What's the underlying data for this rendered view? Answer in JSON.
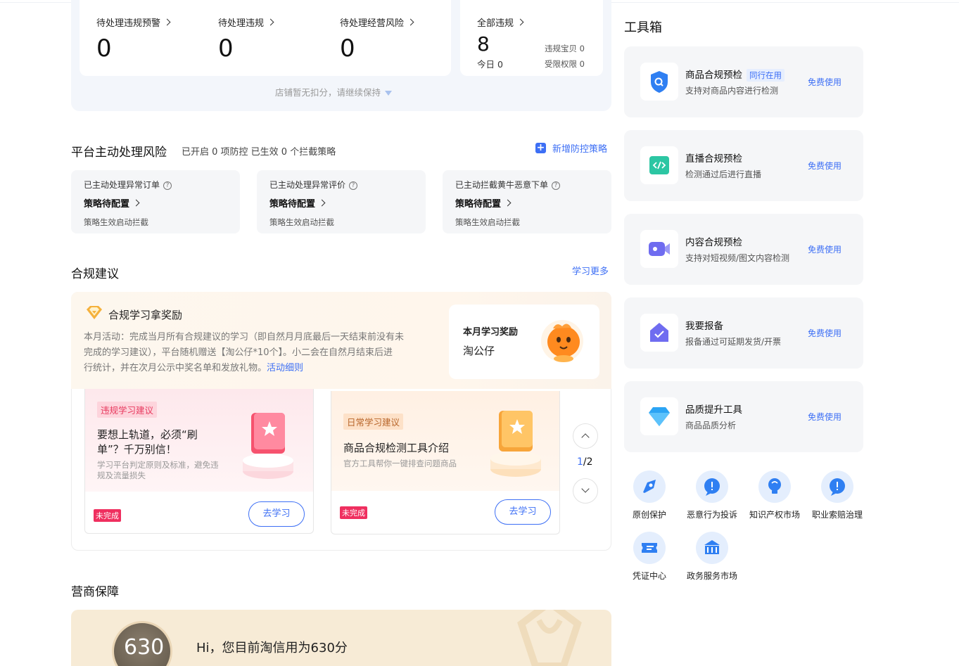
{
  "pending": {
    "items": [
      {
        "label": "待处理违规预警",
        "value": "0"
      },
      {
        "label": "待处理违规",
        "value": "0"
      },
      {
        "label": "待处理经营风险",
        "value": "0"
      }
    ],
    "all": {
      "label": "全部违规",
      "value": "8",
      "today": "今日 0",
      "baby": "违规宝贝 0",
      "limited": "受限权限 0"
    },
    "tip": "店铺暂无扣分，请继续保持"
  },
  "platform_risk": {
    "title": "平台主动处理风险",
    "summary": "已开启 0 项防控 已生效 0 个拦截策略",
    "add_label": "新增防控策略",
    "cards": [
      {
        "title": "已主动处理异常订单",
        "status": "策略待配置",
        "desc": "策略生效启动拦截"
      },
      {
        "title": "已主动处理异常评价",
        "status": "策略待配置",
        "desc": "策略生效启动拦截"
      },
      {
        "title": "已主动拦截黄牛恶意下单",
        "status": "策略待配置",
        "desc": "策略生效启动拦截"
      }
    ]
  },
  "compliance": {
    "title": "合规建议",
    "more_label": "学习更多",
    "banner_title": "合规学习拿奖励",
    "banner_lines": [
      "本月活动：完成当月所有合规建议的学习（即自然月月底最后一天结束前没有未",
      "完成的学习建议），平台随机赠送【淘公仔*10个】。小二会在自然月结束后进",
      "行统计，并在次月公示中奖名单和发放礼物。"
    ],
    "banner_link": "活动细则",
    "reward_title": "本月学习奖励",
    "reward_name": "淘公仔",
    "cards": [
      {
        "tag": "违规学习建议",
        "title_lines": [
          "要想上轨道，必须“刷",
          "单”？千万别信！"
        ],
        "desc_lines": [
          "学习平台判定原则及标准，避免违",
          "规及流量损失"
        ],
        "status": "未完成",
        "button": "去学习"
      },
      {
        "tag": "日常学习建议",
        "title_lines": [
          "商品合规检测工具介绍"
        ],
        "desc_lines": [
          "官方工具帮你一键排查问题商品"
        ],
        "status": "未完成",
        "button": "去学习"
      }
    ],
    "page_current": "1",
    "page_total": "/2"
  },
  "credit": {
    "title": "营商保障",
    "score": "630",
    "text": "Hi，您目前淘信用为630分"
  },
  "toolbox": {
    "title": "工具箱",
    "tools": [
      {
        "name": "商品合规预检",
        "badge": "同行在用",
        "desc": "支持对商品内容进行检测",
        "action": "免费使用",
        "icon": "shield-search-icon",
        "color": "#2f7ff2"
      },
      {
        "name": "直播合规预检",
        "badge": "",
        "desc": "检测通过后进行直播",
        "action": "免费使用",
        "icon": "code-icon",
        "color": "#2cc6a3"
      },
      {
        "name": "内容合规预检",
        "badge": "",
        "desc": "支持对短视频/图文内容检测",
        "action": "免费使用",
        "icon": "video-camera-icon",
        "color": "#6f6cf0"
      },
      {
        "name": "我要报备",
        "badge": "",
        "desc": "报备通过可延期发货/开票",
        "action": "免费使用",
        "icon": "check-house-icon",
        "color": "#6f6cf0"
      },
      {
        "name": "品质提升工具",
        "badge": "",
        "desc": "商品品质分析",
        "action": "免费使用",
        "icon": "diamond-icon",
        "color": "#2ba4f4"
      }
    ],
    "services": [
      {
        "label": "原创保护",
        "icon": "original-protect-icon"
      },
      {
        "label": "恶意行为投诉",
        "icon": "alert-bubble-icon"
      },
      {
        "label": "知识产权市场",
        "icon": "lightbulb-icon"
      },
      {
        "label": "职业索赔治理",
        "icon": "alert-bubble-icon"
      },
      {
        "label": "凭证中心",
        "icon": "ticket-icon"
      },
      {
        "label": "政务服务市场",
        "icon": "government-building-icon"
      }
    ]
  }
}
